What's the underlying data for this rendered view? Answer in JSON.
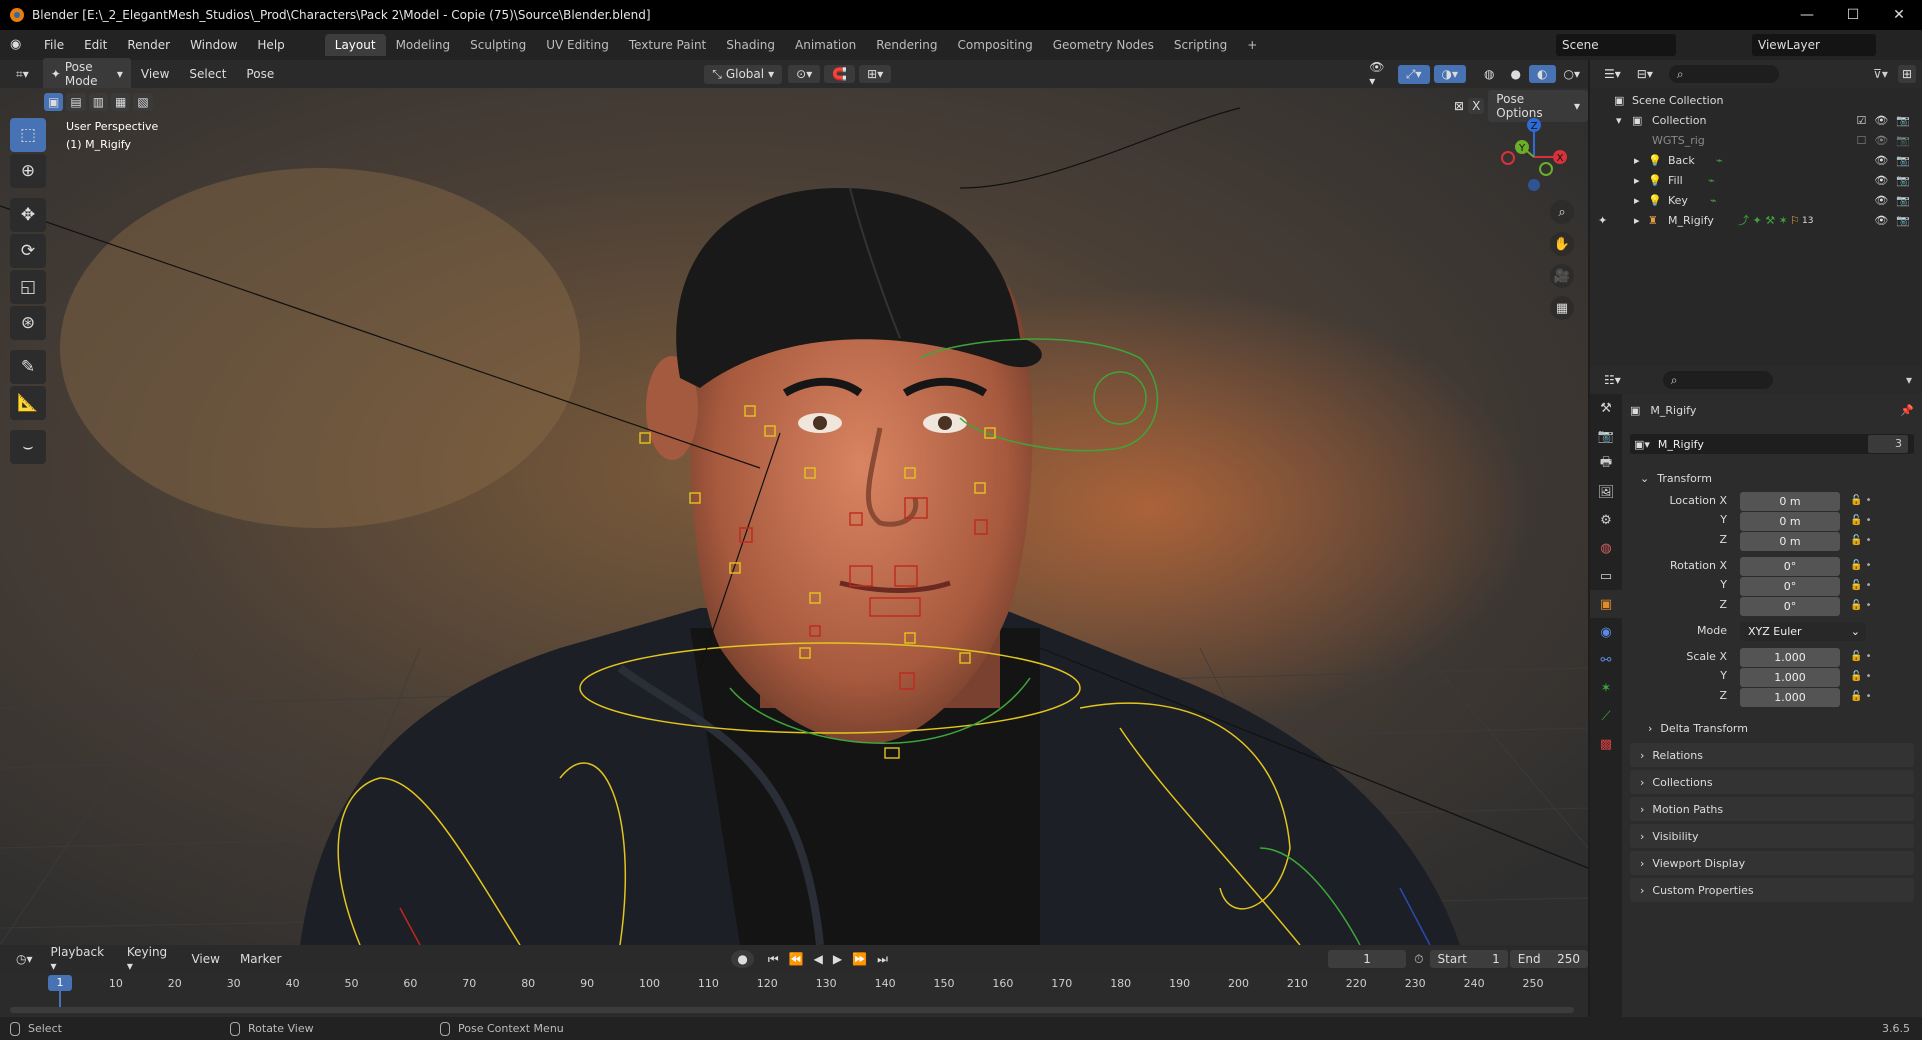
{
  "window": {
    "title": "Blender [E:\\_2_ElegantMesh_Studios\\_Prod\\Characters\\Pack 2\\Model - Copie (75)\\Source\\Blender.blend]"
  },
  "menu": {
    "items": [
      "File",
      "Edit",
      "Render",
      "Window",
      "Help"
    ]
  },
  "workspaces": {
    "tabs": [
      "Layout",
      "Modeling",
      "Sculpting",
      "UV Editing",
      "Texture Paint",
      "Shading",
      "Animation",
      "Rendering",
      "Compositing",
      "Geometry Nodes",
      "Scripting"
    ],
    "active": "Layout",
    "add": "+"
  },
  "scene": {
    "name": "Scene",
    "view_layer": "ViewLayer"
  },
  "viewport": {
    "mode": "Pose Mode",
    "menus": [
      "View",
      "Select",
      "Pose"
    ],
    "orientation": "Global",
    "pose_options": "Pose Options",
    "overlay_title": "User Perspective",
    "overlay_object": "(1) M_Rigify",
    "axes": {
      "x": "X",
      "y": "Y",
      "z": "Z"
    }
  },
  "outliner": {
    "root": "Scene Collection",
    "collection": "Collection",
    "items": [
      {
        "label": "WGTS_rig",
        "dim": true
      },
      {
        "label": "Back"
      },
      {
        "label": "Fill"
      },
      {
        "label": "Key"
      },
      {
        "label": "M_Rigify",
        "badge": "13"
      }
    ]
  },
  "properties": {
    "object_name": "M_Rigify",
    "data_name": "M_Rigify",
    "users": "3",
    "transform_label": "Transform",
    "location": {
      "label": "Location X",
      "y": "Y",
      "z": "Z",
      "values": [
        "0 m",
        "0 m",
        "0 m"
      ]
    },
    "rotation": {
      "label": "Rotation X",
      "y": "Y",
      "z": "Z",
      "values": [
        "0°",
        "0°",
        "0°"
      ]
    },
    "mode": {
      "label": "Mode",
      "value": "XYZ Euler"
    },
    "scale": {
      "label": "Scale X",
      "y": "Y",
      "z": "Z",
      "values": [
        "1.000",
        "1.000",
        "1.000"
      ]
    },
    "delta": "Delta Transform",
    "sections": [
      "Relations",
      "Collections",
      "Motion Paths",
      "Visibility",
      "Viewport Display",
      "Custom Properties"
    ]
  },
  "timeline": {
    "menus": [
      "Playback",
      "Keying",
      "View",
      "Marker"
    ],
    "current_frame": "1",
    "start_label": "Start",
    "start": "1",
    "end_label": "End",
    "end": "250",
    "ticks": [
      "1",
      "10",
      "20",
      "30",
      "40",
      "50",
      "60",
      "70",
      "80",
      "90",
      "100",
      "110",
      "120",
      "130",
      "140",
      "150",
      "160",
      "170",
      "180",
      "190",
      "200",
      "210",
      "220",
      "230",
      "240",
      "250"
    ]
  },
  "statusbar": {
    "select": "Select",
    "rotate": "Rotate View",
    "context": "Pose Context Menu",
    "version": "3.6.5"
  },
  "colors": {
    "accent": "#4772b3",
    "rig_yellow": "#e3c51e",
    "rig_green": "#3fa53a",
    "rig_red": "#c0281e"
  }
}
